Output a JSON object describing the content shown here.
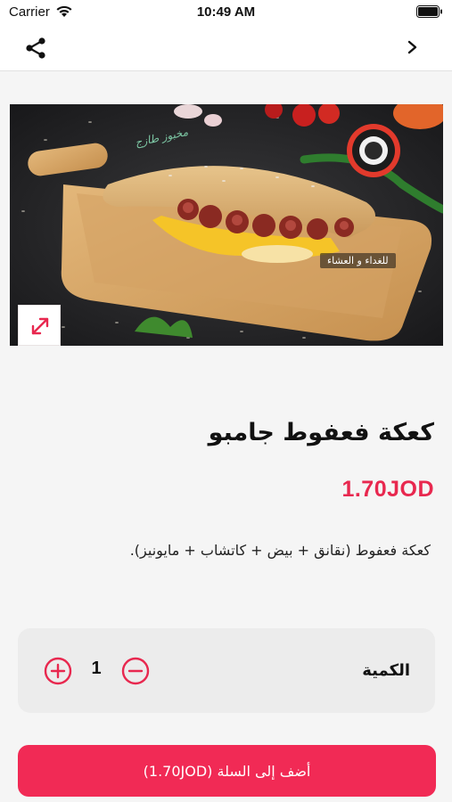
{
  "status_bar": {
    "carrier": "Carrier",
    "time": "10:49 AM"
  },
  "nav": {
    "share_icon": "share-icon",
    "back_icon": "chevron-right-icon"
  },
  "hero": {
    "tag_text": "للغداء و العشاء",
    "script_text": "مخبوز طازج",
    "expand_icon": "expand-diagonal-icon"
  },
  "product": {
    "title": "كعكة فعفوط جامبو",
    "price": "1.70JOD",
    "description": "كعكة فعفوط (نقانق + بيض + كاتشاب + مايونيز)."
  },
  "quantity": {
    "label": "الكمية",
    "value": "1",
    "plus_icon": "plus-circle-icon",
    "minus_icon": "minus-circle-icon"
  },
  "cart_button": {
    "label": "أضف إلى السلة (1.70JOD)"
  },
  "colors": {
    "accent": "#e8284f",
    "button_bg": "#f12a55",
    "card_bg": "#ececec",
    "page_bg": "#f5f5f5"
  }
}
